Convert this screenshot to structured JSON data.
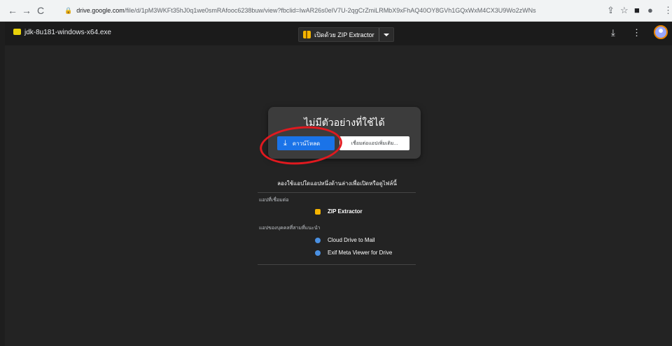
{
  "browser": {
    "back_icon": "back-arrow-icon",
    "forward_icon": "forward-arrow-icon",
    "reload_icon": "reload-icon",
    "url_host": "drive.google.com",
    "url_path": "/file/d/1pM3WKFt35hJ0q1we0smRAfooc6238buw/view?fbclid=IwAR26s0eIV7U-2qgCrZmiLRMbX9xFhAQ40OY8GVh1GQxWxM4CX3U9Wo2zWNs"
  },
  "viewer": {
    "filename": "jdk-8u181-windows-x64.exe",
    "open_with_label": "เปิดด้วย ZIP Extractor",
    "colors": {
      "background": "#232323",
      "accent": "#1a73e8",
      "file_icon": "#e8d10a"
    }
  },
  "preview_card": {
    "title": "ไม่มีตัวอย่างที่ใช้ได้",
    "download_label": "ดาวน์โหลด",
    "connect_label": "เชื่อมต่อแอปเพิ่มเติม..."
  },
  "suggestions": {
    "heading": "ลองใช้แอปใดแอปหนึ่งด้านล่างเพื่อเปิดหรือดูไฟล์นี้",
    "connected_label": "แอปที่เชื่อมต่อ",
    "connected_apps": [
      {
        "name": "ZIP Extractor",
        "icon": "zip-extractor-icon",
        "color": "#f5b400"
      }
    ],
    "suggested_label": "แอปของบุคคลที่สามที่แนะนำ",
    "suggested_apps": [
      {
        "name": "Cloud Drive to Mail",
        "icon": "cloud-drive-to-mail-icon",
        "color": "#4a90e2"
      },
      {
        "name": "Exif Meta Viewer for Drive",
        "icon": "exif-viewer-icon",
        "color": "#4a90e2"
      }
    ]
  }
}
